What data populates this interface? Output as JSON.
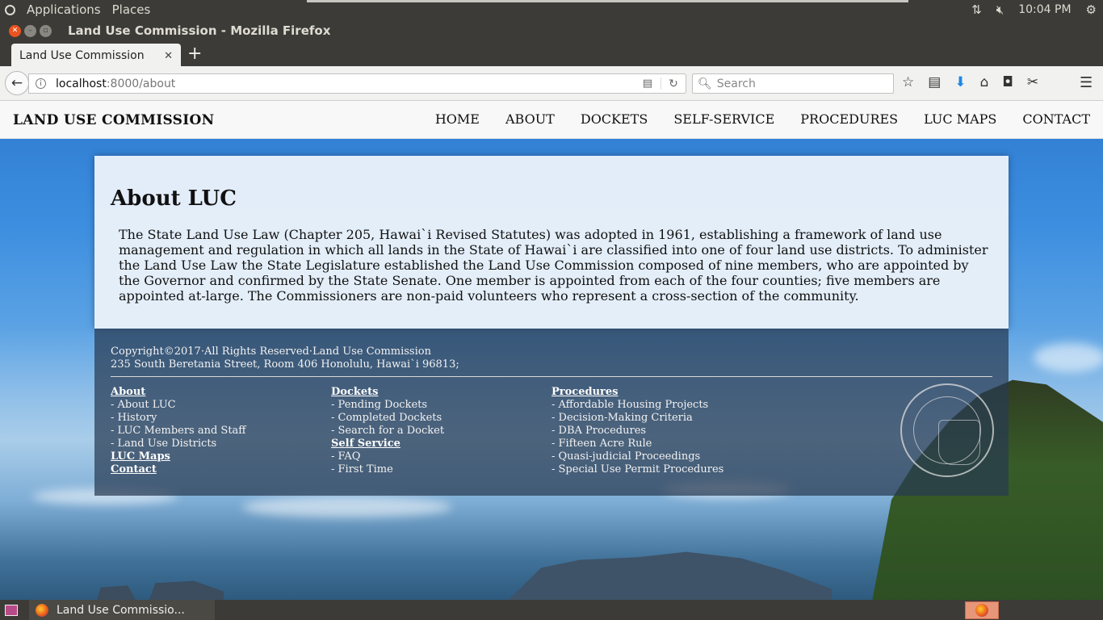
{
  "os_panel": {
    "applications": "Applications",
    "places": "Places",
    "time": "10:04 PM",
    "icons": [
      "ubuntu-logo-icon",
      "network-arrows-icon",
      "volume-muted-icon",
      "settings-gear-icon"
    ]
  },
  "window": {
    "title": "Land Use Commission - Mozilla Firefox"
  },
  "tabs": [
    {
      "label": "Land Use Commission",
      "active": true
    }
  ],
  "new_tab": "+",
  "navbar": {
    "url_host": "localhost",
    "url_path": ":8000/about",
    "search_placeholder": "Search"
  },
  "site": {
    "brand": "LAND USE COMMISSION",
    "nav": [
      "HOME",
      "ABOUT",
      "DOCKETS",
      "SELF-SERVICE",
      "PROCEDURES",
      "LUC MAPS",
      "CONTACT"
    ]
  },
  "content": {
    "heading": "About LUC",
    "body": "The State Land Use Law (Chapter 205, Hawai`i Revised Statutes) was adopted in 1961, establishing a framework of land use management and regulation in which all lands in the State of Hawai`i are classified into one of four land use districts. To administer the Land Use Law the State Legislature established the Land Use Commission composed of nine members, who are appointed by the Governor and confirmed by the State Senate. One member is appointed from each of the four counties; five members are appointed at-large. The Commissioners are non-paid volunteers who represent a cross-section of the community."
  },
  "footer": {
    "copyright": "Copyright©2017·All Rights Reserved·Land Use Commission",
    "address": "235 South Beretania Street, Room 406 Honolulu, Hawai`i 96813;",
    "col1": {
      "about": "About",
      "about_items": [
        "- About LUC",
        "- History",
        "- LUC Members and Staff",
        "- Land Use Districts"
      ],
      "luc_maps": "LUC Maps",
      "contact": "Contact"
    },
    "col2": {
      "dockets": "Dockets",
      "docket_items": [
        "- Pending Dockets",
        "- Completed Dockets",
        "- Search for a Docket"
      ],
      "self_service": "Self Service",
      "self_service_items": [
        "- FAQ",
        "- First Time"
      ]
    },
    "col3": {
      "procedures": "Procedures",
      "procedure_items": [
        "- Affordable Housing Projects",
        "- Decision-Making Criteria",
        "- DBA Procedures",
        "- Fifteen Acre Rule",
        "- Quasi-judicial Proceedings",
        "- Special Use Permit Procedures"
      ]
    }
  },
  "taskbar": {
    "task_label": "Land Use Commissio..."
  }
}
